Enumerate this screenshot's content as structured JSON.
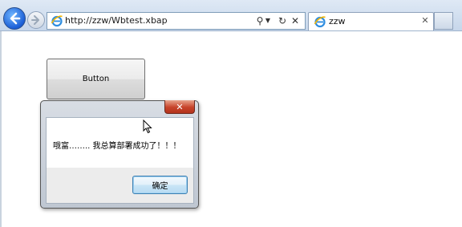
{
  "browser": {
    "address": {
      "url": "http://zzw/Wbtest.xbap"
    },
    "tab": {
      "title": "zzw"
    }
  },
  "page": {
    "button_label": "Button"
  },
  "message_box": {
    "close_label": "✕",
    "message": "哦富…….. 我总算部署成功了！！！",
    "ok_label": "确定"
  },
  "icons": {
    "back": "back-arrow-icon",
    "forward": "forward-arrow-icon",
    "ie_logo": "ie-logo-icon",
    "search": "search-icon",
    "dropdown": "chevron-down-icon",
    "refresh": "refresh-icon",
    "stop": "close-icon",
    "cursor": "mouse-pointer-icon"
  },
  "colors": {
    "accent": "#1b5ed6",
    "close_red": "#c7432a",
    "ok_border": "#3c7fb1"
  }
}
